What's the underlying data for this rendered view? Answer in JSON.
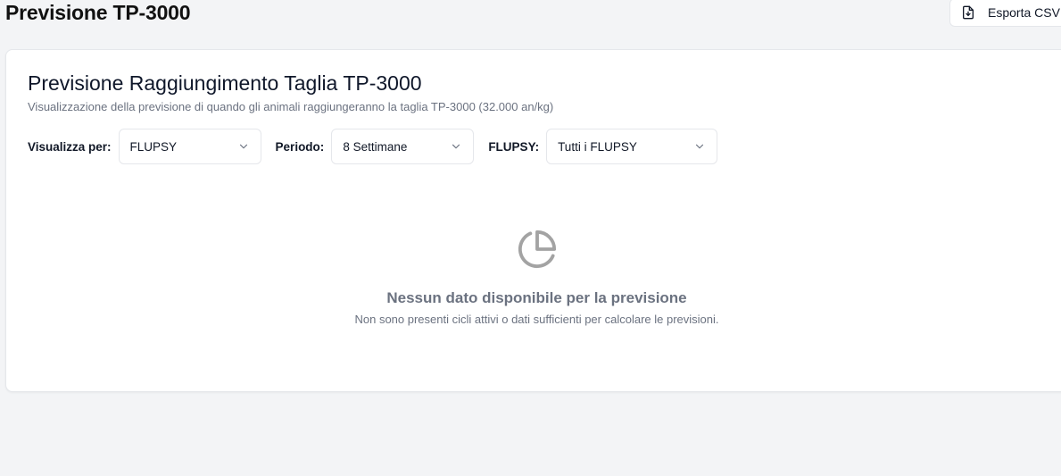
{
  "header": {
    "title": "Previsione TP-3000",
    "export_label": "Esporta CSV"
  },
  "card": {
    "title": "Previsione Raggiungimento Taglia TP-3000",
    "subtitle": "Visualizzazione della previsione di quando gli animali raggiungeranno la taglia TP-3000 (32.000 an/kg)"
  },
  "filters": {
    "view_label": "Visualizza per:",
    "view_value": "FLUPSY",
    "period_label": "Periodo:",
    "period_value": "8 Settimane",
    "flupsy_label": "FLUPSY:",
    "flupsy_value": "Tutti i FLUPSY"
  },
  "empty_state": {
    "icon": "pie-chart-icon",
    "title": "Nessun dato disponibile per la previsione",
    "description": "Non sono presenti cicli attivi o dati sufficienti per calcolare le previsioni."
  },
  "colors": {
    "background": "#f3f4f6",
    "card": "#ffffff",
    "muted_text": "#6b7280",
    "icon_gray": "#a3a3a3"
  }
}
